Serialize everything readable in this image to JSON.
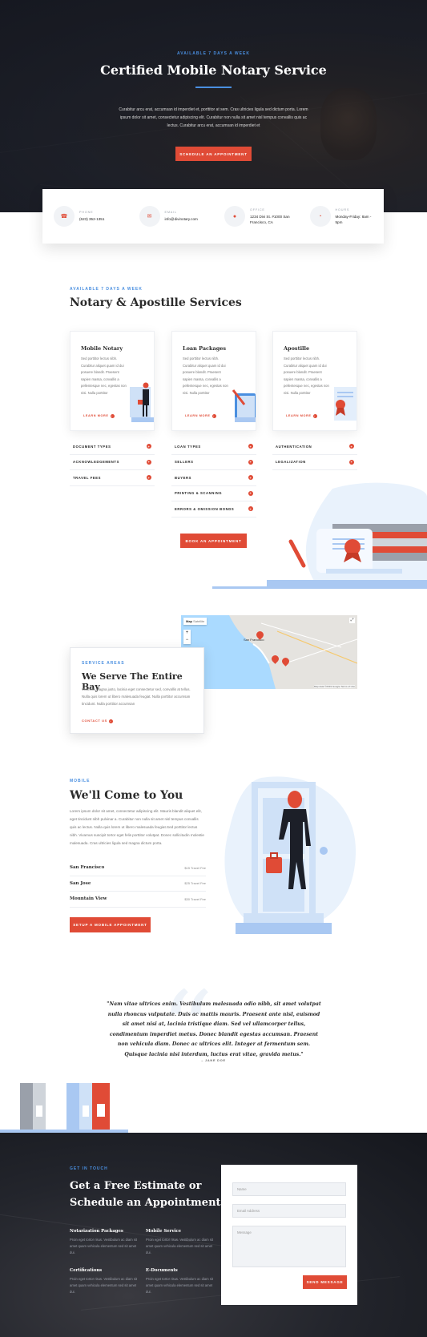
{
  "hero": {
    "eyebrow": "AVAILABLE 7 DAYS A WEEK",
    "title": "Certified Mobile Notary Service",
    "text": "Curabitur arcu erat, accumsan id imperdiet et, porttitor at sem. Cras ultricies ligula sed dictum porta. Lorem ipsum dolor sit amet, consectetur adipiscing elit. Curabitur non nulla sit amet nisl tempus convallis quis ac lectus. Curabitur arcu erat, accumsan id imperdiet et",
    "cta": "SCHEDULE AN APPOINTMENT"
  },
  "info": [
    {
      "label": "PHONE",
      "value": "(623) 352-1351",
      "icon": "phone-icon"
    },
    {
      "label": "EMAIL",
      "value": "info@divinotary.com",
      "icon": "mail-icon"
    },
    {
      "label": "OFFICE",
      "value": "1234 Divi St. #1000 San Francisco, CA",
      "icon": "pin-icon"
    },
    {
      "label": "HOURS",
      "value": "Monday-Friday: 8am - 5pm",
      "icon": "clock-icon"
    }
  ],
  "services": {
    "eyebrow": "AVAILABLE 7 DAYS A WEEK",
    "title": "Notary & Apostille Services",
    "cards": [
      {
        "title": "Mobile Notary",
        "text": "Sed porttitor lectus nibh. Curabitur aliquet quam id dui posuere blandit. Praesent sapien massa, convallis a pellentesque nec, egestas non nisi. Nulla porttitor",
        "link": "LEARN MORE"
      },
      {
        "title": "Loan Packages",
        "text": "Sed porttitor lectus nibh. Curabitur aliquet quam id dui posuere blandit. Praesent sapien massa, convallis a pellentesque nec, egestas non nisi. Nulla porttitor",
        "link": "LEARN MORE"
      },
      {
        "title": "Apostille",
        "text": "Sed porttitor lectus nibh. Curabitur aliquet quam id dui posuere blandit. Praesent sapien massa, convallis a pellentesque nec, egestas non nisi. Nulla porttitor",
        "link": "LEARN MORE"
      }
    ],
    "col1": [
      "DOCUMENT TYPES",
      "ACKNOWLEDGEMENTS",
      "TRAVEL FEES"
    ],
    "col2": [
      "LOAN TYPES",
      "SELLERS",
      "BUYERS",
      "PRINTING & SCANNING",
      "ERRORS & OMISSION BONDS"
    ],
    "col3": [
      "AUTHENTICATION",
      "LEGALIZATION"
    ],
    "cta": "BOOK AN APPOINTMENT"
  },
  "map": {
    "tab_map": "Map",
    "tab_satellite": "Satellite",
    "zoom_in": "+",
    "zoom_out": "−",
    "city": "San Francisco",
    "footer": "Map data ©2019 Google   Terms of Use"
  },
  "area": {
    "eyebrow": "SERVICE AREAS",
    "title": "We Serve The Entire Bay",
    "text": "Vivamus magna justo, lacinia eget consectetur sed, convallis at tellus. Nulla quis lorem ut libero malesuada feugiat. Nulla porttitor accumsan tincidunt. Nulla porttitor accumsan",
    "link": "CONTACT US"
  },
  "mobile": {
    "eyebrow": "MOBILE",
    "title": "We'll Come to You",
    "text": "Lorem ipsum dolor sit amet, consectetur adipiscing elit. Mauris blandit aliquet elit, eget tincidunt nibh pulvinar a. Curabitur non nulla sit amet nisl tempus convallis quis ac lectus. Nulla quis lorem ut libero malesuada feugiat.Sed porttitor lectus nibh. Vivamus suscipit tortor eget felis porttitor volutpat. Donec sollicitudin molestie malesuada. Cras ultricies ligula sed magna dictum porta.",
    "locations": [
      {
        "name": "San Francisco",
        "fee": "$15 Travel Fee"
      },
      {
        "name": "San Jose",
        "fee": "$25 Travel Fee"
      },
      {
        "name": "Mountain View",
        "fee": "$30 Travel Fee"
      }
    ],
    "cta": "SETUP A MOBILE APPOINTMENT"
  },
  "testimonial": {
    "quote": "\"Nam vitae ultrices enim. Vestibulum malesuada odio nibh, sit amet volutpat nulla rhoncus vulputate. Duis ac mattis mauris. Praesent ante nisl, euismod sit amet nisi at, lacinia tristique diam. Sed vel ullamcorper tellus, condimentum imperdiet metus. Donec blandit egestas accumsan. Praesent non vehicula diam. Donec ac ultrices elit. Integer at fermentum sem. Quisque lacinia nisi interdum, luctus erat vitae, gravida metus.\"",
    "author": "– JANE DOE"
  },
  "contact": {
    "eyebrow": "GET IN TOUCH",
    "title": "Get a Free Estimate or Schedule an Appointment",
    "cols": [
      {
        "title": "Notarization Packages",
        "text": "Proin eget tortor risus. Vestibulum ac diam sit amet quam vehicula elementum sed sit amet dui."
      },
      {
        "title": "Mobile Service",
        "text": "Proin eget tortor risus. Vestibulum ac diam sit amet quam vehicula elementum sed sit amet dui."
      },
      {
        "title": "Certifications",
        "text": "Proin eget tortor risus. Vestibulum ac diam sit amet quam vehicula elementum sed sit amet dui."
      },
      {
        "title": "E-Documents",
        "text": "Proin eget tortor risus. Vestibulum ac diam sit amet quam vehicula elementum sed sit amet dui."
      }
    ],
    "form": {
      "name": "Name",
      "email": "Email Address",
      "message": "Message",
      "submit": "SEND MESSAGE"
    }
  },
  "colors": {
    "accent": "#e04b36",
    "blue": "#4a8fe0",
    "light_blue": "#a9c8f2",
    "dark": "#1c1f28"
  }
}
